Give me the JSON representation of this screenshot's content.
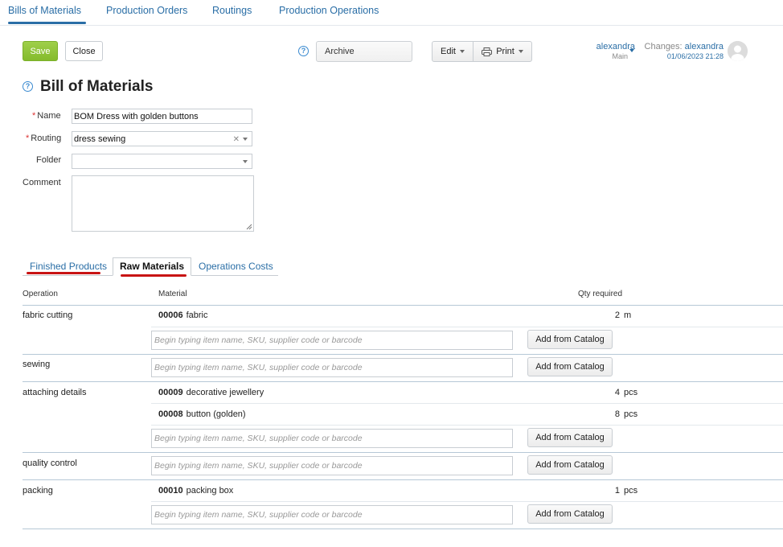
{
  "nav": {
    "items": [
      {
        "label": "Bills of Materials",
        "active": true
      },
      {
        "label": "Production Orders"
      },
      {
        "label": "Routings"
      },
      {
        "label": "Production Operations"
      }
    ]
  },
  "toolbar": {
    "save_label": "Save",
    "close_label": "Close",
    "status_value": "Archive",
    "edit_label": "Edit",
    "print_label": "Print"
  },
  "user": {
    "name": "alexandra",
    "context": "Main"
  },
  "changes": {
    "label": "Changes:",
    "user": "alexandra",
    "date": "01/06/2023 21:28"
  },
  "page": {
    "title": "Bill of Materials"
  },
  "form": {
    "name_label": "Name",
    "name_value": "BOM Dress with golden buttons",
    "routing_label": "Routing",
    "routing_value": "dress sewing",
    "folder_label": "Folder",
    "folder_value": "",
    "comment_label": "Comment",
    "comment_value": ""
  },
  "tabs": [
    {
      "label": "Finished Products"
    },
    {
      "label": "Raw Materials",
      "active": true
    },
    {
      "label": "Operations Costs"
    }
  ],
  "table": {
    "headers": {
      "operation": "Operation",
      "material": "Material",
      "qty": "Qty required"
    },
    "search_placeholder": "Begin typing item name, SKU, supplier code or barcode",
    "catalog_button": "Add from Catalog",
    "operations": [
      {
        "name": "fabric cutting",
        "materials": [
          {
            "code": "00006",
            "name": "fabric",
            "qty": "2",
            "unit": "m"
          }
        ]
      },
      {
        "name": "sewing",
        "materials": []
      },
      {
        "name": "attaching details",
        "materials": [
          {
            "code": "00009",
            "name": "decorative jewellery",
            "qty": "4",
            "unit": "pcs"
          },
          {
            "code": "00008",
            "name": "button (golden)",
            "qty": "8",
            "unit": "pcs"
          }
        ]
      },
      {
        "name": "quality control",
        "materials": []
      },
      {
        "name": "packing",
        "materials": [
          {
            "code": "00010",
            "name": "packing box",
            "qty": "1",
            "unit": "pcs"
          }
        ]
      }
    ]
  },
  "colors": {
    "link": "#2a6ea6",
    "save_button": "#8fc43a",
    "required_star": "#dd3333",
    "annotation_underline": "#c81414"
  }
}
